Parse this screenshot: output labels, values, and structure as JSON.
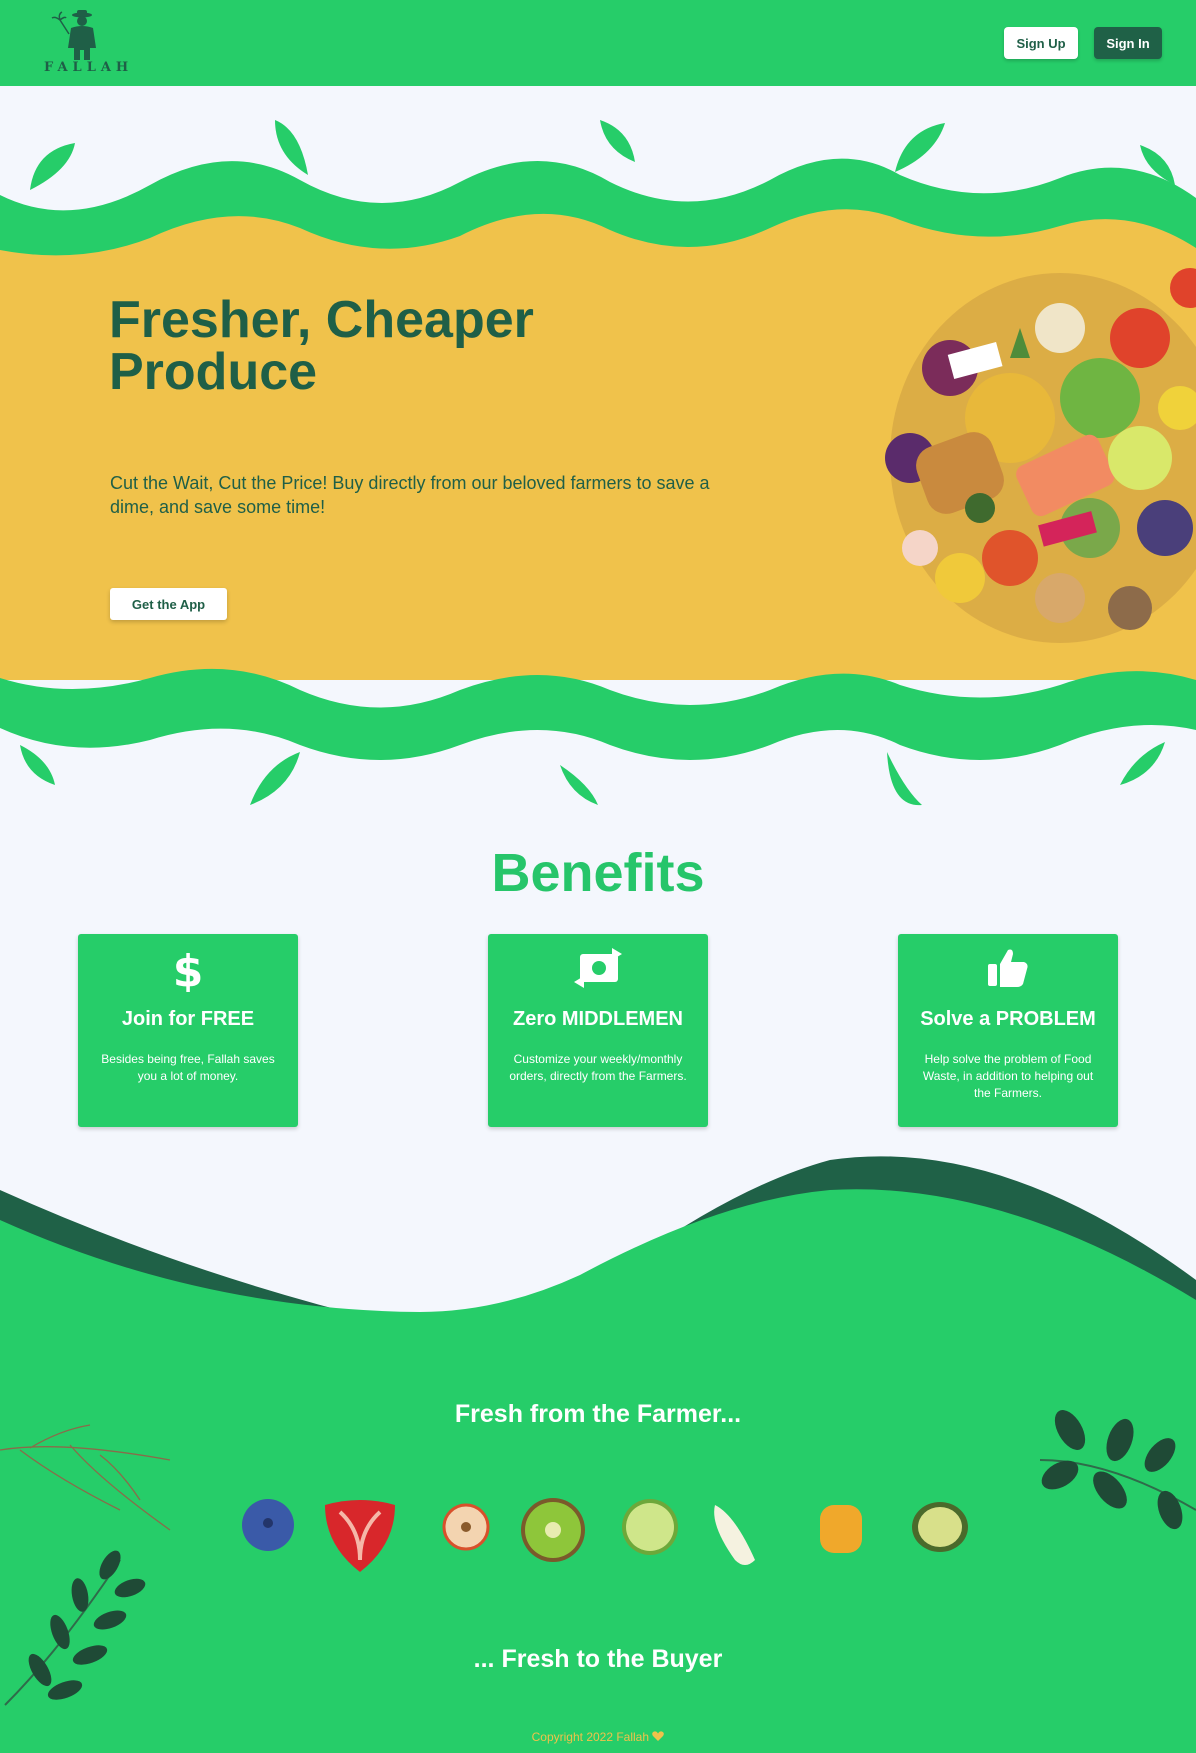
{
  "header": {
    "logo_text": "FALLAH",
    "signup_label": "Sign Up",
    "signin_label": "Sign In"
  },
  "hero": {
    "title_line1": "Fresher, Cheaper",
    "title_line2": "Produce",
    "subtitle": "Cut the Wait, Cut the Price! Buy directly from our beloved farmers to save a dime, and save some time!",
    "cta_label": "Get the App"
  },
  "benefits": {
    "title": "Benefits",
    "cards": [
      {
        "icon": "dollar-icon",
        "title": "Join for FREE",
        "description": "Besides being free, Fallah saves you a lot of money."
      },
      {
        "icon": "money-exchange-icon",
        "title": "Zero MIDDLEMEN",
        "description": "Customize your weekly/monthly orders, directly from the Farmers."
      },
      {
        "icon": "thumbs-up-icon",
        "title": "Solve a PROBLEM",
        "description": "Help solve the problem of Food Waste, in addition to helping out the Farmers."
      }
    ]
  },
  "farm": {
    "heading_top": "Fresh from the Farmer...",
    "heading_bottom": "... Fresh to the Buyer",
    "fruits": [
      "blueberry",
      "strawberry",
      "apple-slice",
      "kiwi",
      "lime",
      "pear-slice",
      "mango",
      "avocado"
    ]
  },
  "footer": {
    "copyright": "Copyright 2022 Fallah",
    "heart_icon": "heart-icon"
  },
  "colors": {
    "green": "#26cd69",
    "dark_green": "#1f6147",
    "yellow": "#f0c24b",
    "background": "#f4f7fd"
  }
}
